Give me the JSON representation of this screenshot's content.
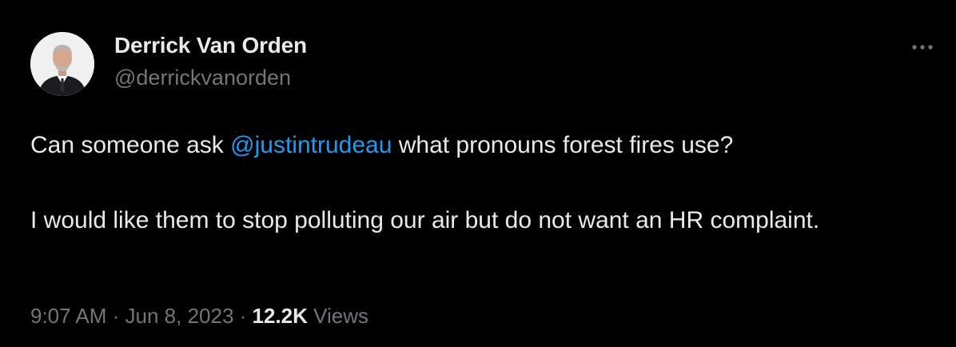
{
  "author": {
    "display_name": "Derrick Van Orden",
    "handle": "@derrickvanorden"
  },
  "tweet": {
    "line1_before": "Can someone ask ",
    "mention": "@justintrudeau",
    "line1_after": " what pronouns forest fires use?",
    "paragraph2": "I would like them to stop polluting our air but do not want an HR complaint."
  },
  "meta": {
    "time": "9:07 AM",
    "separator": " · ",
    "date": "Jun 8, 2023",
    "views_count": "12.2K",
    "views_label": " Views"
  },
  "colors": {
    "background": "#000000",
    "text_primary": "#e7e9ea",
    "text_secondary": "#71767b",
    "link": "#1d9bf0"
  },
  "icons": {
    "more": "more-horizontal-icon",
    "avatar": "profile-photo"
  }
}
